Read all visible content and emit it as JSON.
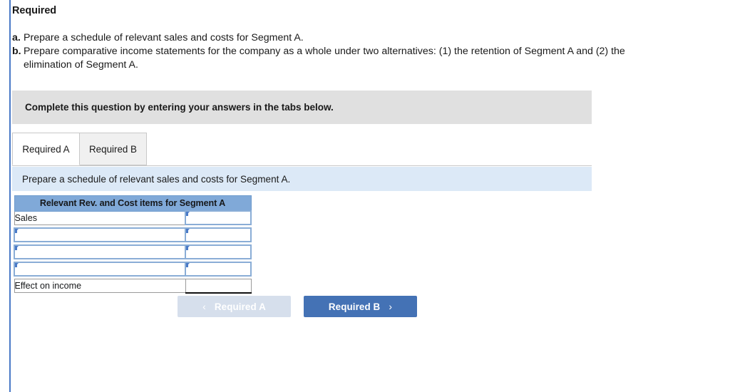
{
  "problem": {
    "heading": "Required",
    "items": [
      {
        "marker": "a.",
        "text": "Prepare a schedule of relevant sales and costs for Segment A."
      },
      {
        "marker": "b.",
        "text": "Prepare comparative income statements for the company as a whole under two alternatives: (1) the retention of Segment A and (2) the elimination of Segment A."
      }
    ]
  },
  "instruction_band": {
    "text": "Complete this question by entering your answers in the tabs below."
  },
  "tabs": [
    {
      "label": "Required A",
      "active": true
    },
    {
      "label": "Required B",
      "active": false
    }
  ],
  "sub_instruction": {
    "text": "Prepare a schedule of relevant sales and costs for Segment A."
  },
  "answer_table": {
    "header": "Relevant Rev. and Cost items for Segment A",
    "rows": [
      {
        "label": "Sales",
        "label_editable": false,
        "value": "",
        "value_editable": true,
        "total": false
      },
      {
        "label": "",
        "label_editable": true,
        "value": "",
        "value_editable": true,
        "total": false
      },
      {
        "label": "",
        "label_editable": true,
        "value": "",
        "value_editable": true,
        "total": false
      },
      {
        "label": "",
        "label_editable": true,
        "value": "",
        "value_editable": true,
        "total": false
      },
      {
        "label": "Effect on income",
        "label_editable": false,
        "value": "",
        "value_editable": false,
        "total": true
      }
    ]
  },
  "navigation": {
    "prev_label": "Required A",
    "next_label": "Required B",
    "prev_icon": "chevron-left-icon",
    "next_icon": "chevron-right-icon",
    "prev_chevron": "‹",
    "next_chevron": "›"
  },
  "colors": {
    "rail": "#4a7ac7",
    "band_gray": "#e0e0e0",
    "strip_blue": "#dce9f7",
    "table_header_blue": "#80a9d8",
    "input_border_blue": "#8aadd6",
    "button_primary": "#4472b5",
    "button_disabled": "#d6dfec"
  }
}
